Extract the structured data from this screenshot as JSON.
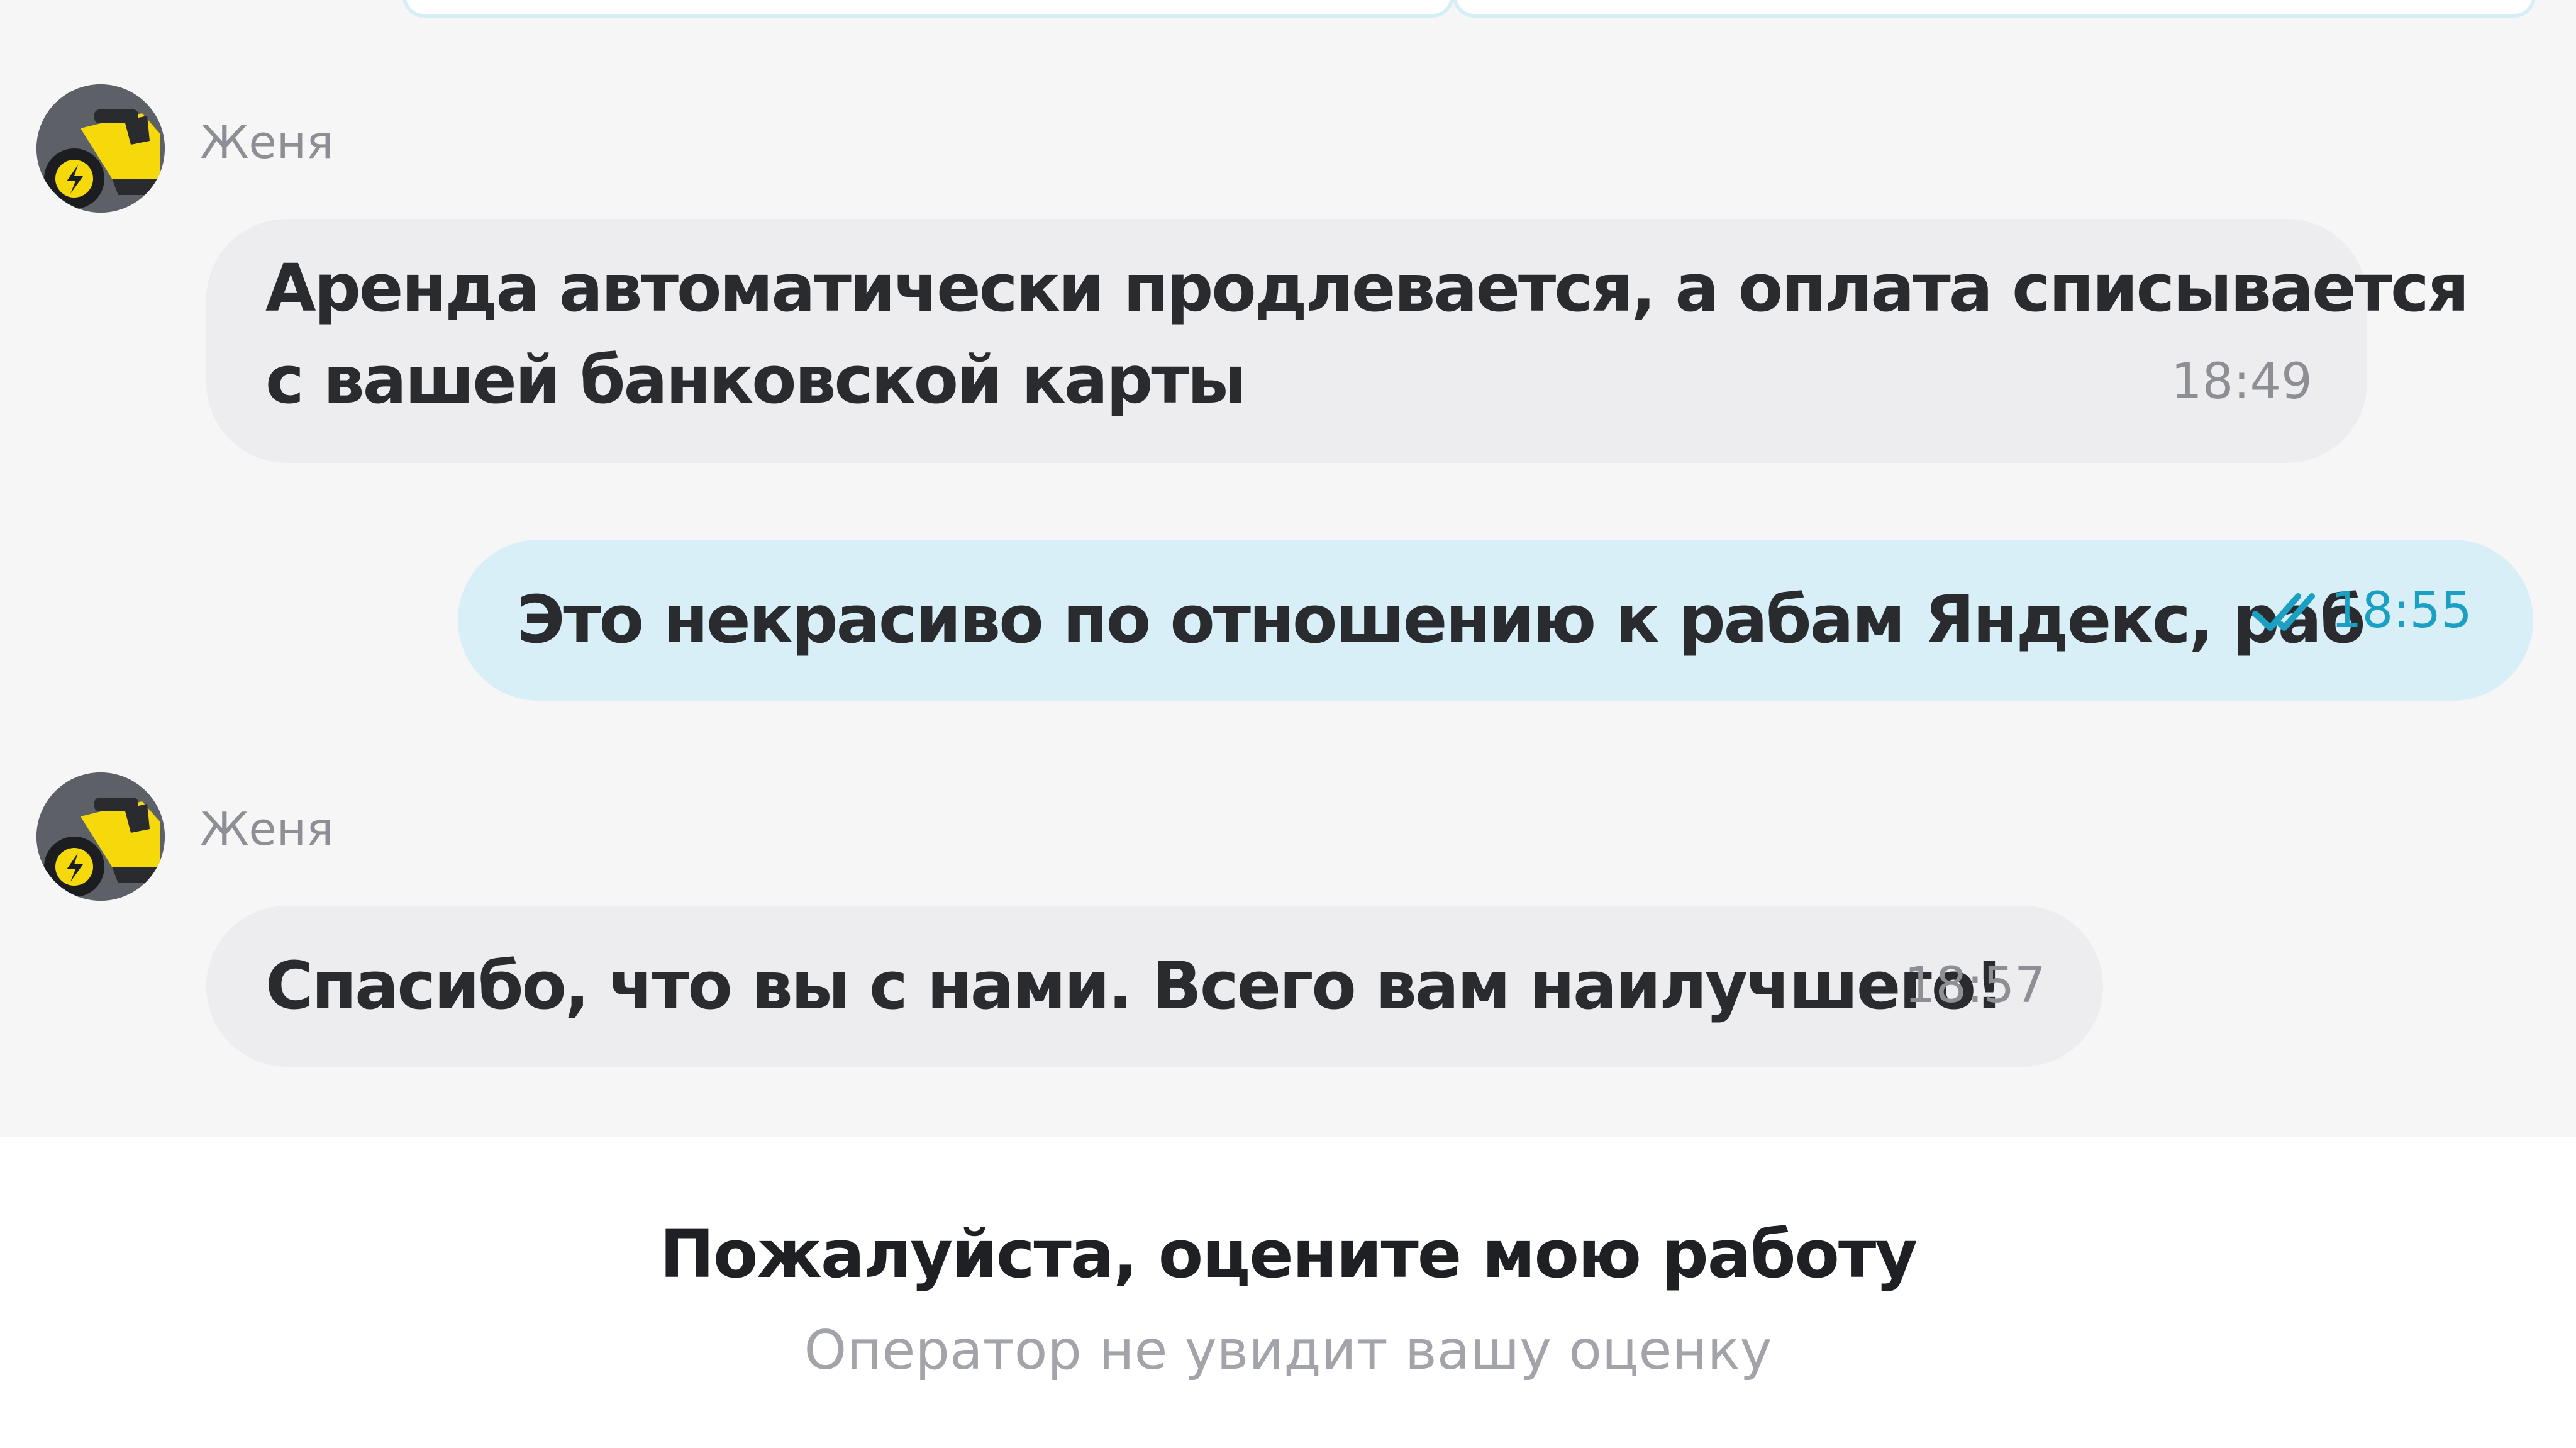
{
  "messages": [
    {
      "sender": "Женя",
      "direction": "incoming",
      "lines": [
        "Аренда автоматически продлевается, а оплата списывается",
        "с вашей банковской карты"
      ],
      "time": "18:49"
    },
    {
      "direction": "outgoing",
      "text": "Это некрасиво по отношению к рабам Яндекс, раб",
      "time": "18:55",
      "status_icon": "double-check-icon"
    },
    {
      "sender": "Женя",
      "direction": "incoming",
      "text": "Спасибо, что вы с нами. Всего вам наилучшего!",
      "time": "18:57"
    }
  ],
  "rating": {
    "title": "Пожалуйста, оцените мою работу",
    "subtitle": "Оператор не увидит вашу оценку"
  },
  "colors": {
    "background": "#f6f6f7",
    "incoming_bubble": "#ededf0",
    "outgoing_bubble": "#d8eff7",
    "accent": "#1ba0c4",
    "avatar_yellow": "#f5d90a"
  },
  "icons": {
    "avatar": "scooter-avatar-icon",
    "read_status": "double-check-icon"
  }
}
